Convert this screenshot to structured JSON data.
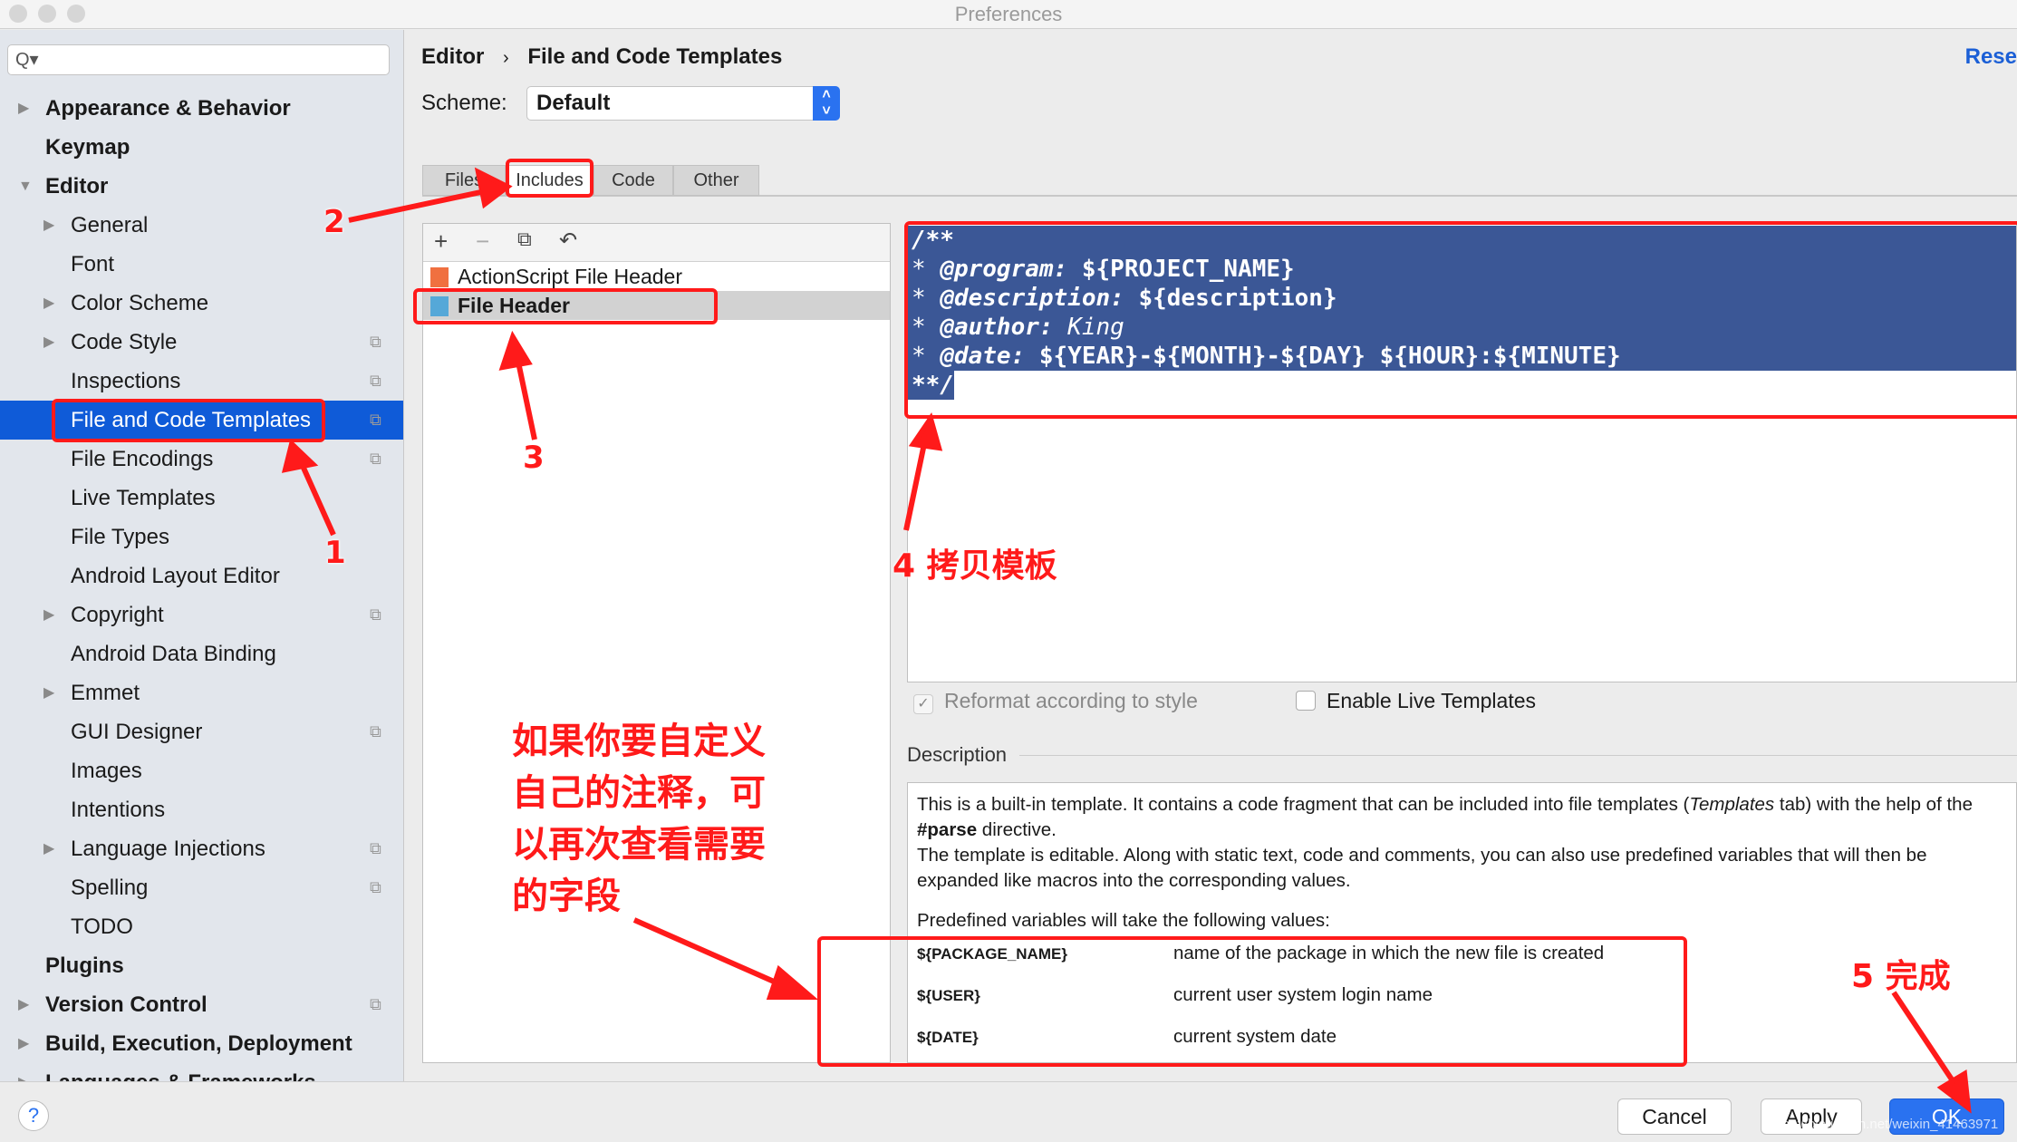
{
  "window": {
    "title": "Preferences"
  },
  "sidebar": {
    "search_placeholder": "Q▾",
    "items": [
      {
        "label": "Appearance & Behavior",
        "level": 0,
        "arrow": "right",
        "bold": true
      },
      {
        "label": "Keymap",
        "level": 0,
        "bold": true
      },
      {
        "label": "Editor",
        "level": 0,
        "arrow": "down",
        "bold": true
      },
      {
        "label": "General",
        "level": 1,
        "arrow": "right"
      },
      {
        "label": "Font",
        "level": 1
      },
      {
        "label": "Color Scheme",
        "level": 1,
        "arrow": "right"
      },
      {
        "label": "Code Style",
        "level": 1,
        "arrow": "right",
        "copy": true
      },
      {
        "label": "Inspections",
        "level": 1,
        "copy": true
      },
      {
        "label": "File and Code Templates",
        "level": 1,
        "copy": true,
        "selected": true
      },
      {
        "label": "File Encodings",
        "level": 1,
        "copy": true
      },
      {
        "label": "Live Templates",
        "level": 1
      },
      {
        "label": "File Types",
        "level": 1
      },
      {
        "label": "Android Layout Editor",
        "level": 1
      },
      {
        "label": "Copyright",
        "level": 1,
        "arrow": "right",
        "copy": true
      },
      {
        "label": "Android Data Binding",
        "level": 1
      },
      {
        "label": "Emmet",
        "level": 1,
        "arrow": "right"
      },
      {
        "label": "GUI Designer",
        "level": 1,
        "copy": true
      },
      {
        "label": "Images",
        "level": 1
      },
      {
        "label": "Intentions",
        "level": 1
      },
      {
        "label": "Language Injections",
        "level": 1,
        "arrow": "right",
        "copy": true
      },
      {
        "label": "Spelling",
        "level": 1,
        "copy": true
      },
      {
        "label": "TODO",
        "level": 1
      },
      {
        "label": "Plugins",
        "level": 0,
        "bold": true
      },
      {
        "label": "Version Control",
        "level": 0,
        "arrow": "right",
        "bold": true,
        "copy": true
      },
      {
        "label": "Build, Execution, Deployment",
        "level": 0,
        "arrow": "right",
        "bold": true
      },
      {
        "label": "Languages & Frameworks",
        "level": 0,
        "arrow": "right",
        "bold": true
      }
    ]
  },
  "header": {
    "breadcrumb_parent": "Editor",
    "breadcrumb_sep": "›",
    "breadcrumb_current": "File and Code Templates",
    "reset_link": "Rese"
  },
  "scheme": {
    "label": "Scheme:",
    "value": "Default"
  },
  "tabs": [
    {
      "label": "Files"
    },
    {
      "label": "Includes",
      "selected": true
    },
    {
      "label": "Code"
    },
    {
      "label": "Other"
    }
  ],
  "list": {
    "toolbar": [
      "plus-icon",
      "minus-icon",
      "copy-icon",
      "reset-icon"
    ],
    "items": [
      {
        "label": "ActionScript File Header",
        "badge": "AS"
      },
      {
        "label": "File Header",
        "badge": "J",
        "selected": true
      }
    ]
  },
  "editor": {
    "lines": [
      "/**",
      "* @program: ${PROJECT_NAME}",
      "* @description: ${description}",
      "* @author: King",
      "* @date: ${YEAR}-${MONTH}-${DAY} ${HOUR}:${MINUTE}",
      "**/"
    ]
  },
  "options": {
    "reformat": {
      "label": "Reformat according to style",
      "checked": true,
      "enabled": false
    },
    "live_templates": {
      "label": "Enable Live Templates",
      "checked": false
    }
  },
  "description": {
    "label": "Description",
    "p1a": "This is a built-in template. It contains a code fragment that can be included into file templates (",
    "p1_italic": "Templates",
    "p1b": " tab) with the help of the ",
    "p1_bold": "#parse",
    "p1c": " directive.",
    "p2": "The template is editable. Along with static text, code and comments, you can also use predefined variables that will then be expanded like macros into the corresponding values.",
    "p3": "Predefined variables will take the following values:",
    "variables": [
      {
        "name": "${PACKAGE_NAME}",
        "desc": "name of the package in which the new file is created"
      },
      {
        "name": "${USER}",
        "desc": "current user system login name"
      },
      {
        "name": "${DATE}",
        "desc": "current system date"
      }
    ]
  },
  "buttons": {
    "help": "?",
    "cancel": "Cancel",
    "apply": "Apply",
    "ok": "OK"
  },
  "annotations": {
    "n1": "1",
    "n2": "2",
    "n3": "3",
    "n4": "4 拷贝模板",
    "n5": "5 完成",
    "note": "如果你要自定义自己的注释，可以再次查看需要的字段",
    "watermark": "https://blog.csdn.net/weixin_41463971"
  },
  "colors": {
    "selection": "#0f5bd8",
    "code_selection": "#3b5796",
    "annotation": "#ff1a1a"
  }
}
